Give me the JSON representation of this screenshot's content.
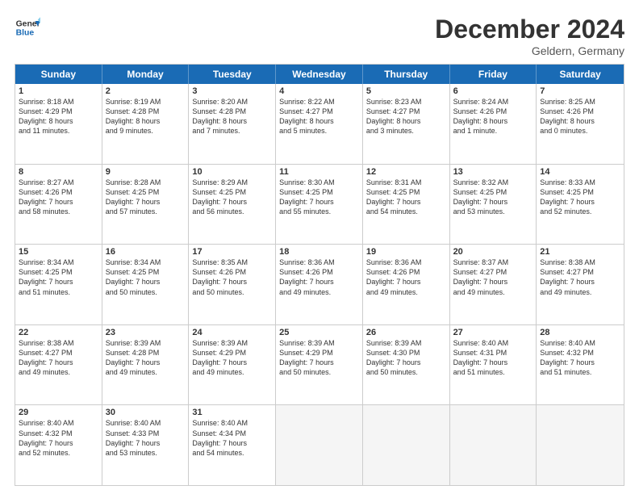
{
  "logo": {
    "line1": "General",
    "line2": "Blue"
  },
  "header": {
    "title": "December 2024",
    "subtitle": "Geldern, Germany"
  },
  "days": [
    "Sunday",
    "Monday",
    "Tuesday",
    "Wednesday",
    "Thursday",
    "Friday",
    "Saturday"
  ],
  "weeks": [
    [
      {
        "day": "1",
        "info": "Sunrise: 8:18 AM\nSunset: 4:29 PM\nDaylight: 8 hours\nand 11 minutes."
      },
      {
        "day": "2",
        "info": "Sunrise: 8:19 AM\nSunset: 4:28 PM\nDaylight: 8 hours\nand 9 minutes."
      },
      {
        "day": "3",
        "info": "Sunrise: 8:20 AM\nSunset: 4:28 PM\nDaylight: 8 hours\nand 7 minutes."
      },
      {
        "day": "4",
        "info": "Sunrise: 8:22 AM\nSunset: 4:27 PM\nDaylight: 8 hours\nand 5 minutes."
      },
      {
        "day": "5",
        "info": "Sunrise: 8:23 AM\nSunset: 4:27 PM\nDaylight: 8 hours\nand 3 minutes."
      },
      {
        "day": "6",
        "info": "Sunrise: 8:24 AM\nSunset: 4:26 PM\nDaylight: 8 hours\nand 1 minute."
      },
      {
        "day": "7",
        "info": "Sunrise: 8:25 AM\nSunset: 4:26 PM\nDaylight: 8 hours\nand 0 minutes."
      }
    ],
    [
      {
        "day": "8",
        "info": "Sunrise: 8:27 AM\nSunset: 4:26 PM\nDaylight: 7 hours\nand 58 minutes."
      },
      {
        "day": "9",
        "info": "Sunrise: 8:28 AM\nSunset: 4:25 PM\nDaylight: 7 hours\nand 57 minutes."
      },
      {
        "day": "10",
        "info": "Sunrise: 8:29 AM\nSunset: 4:25 PM\nDaylight: 7 hours\nand 56 minutes."
      },
      {
        "day": "11",
        "info": "Sunrise: 8:30 AM\nSunset: 4:25 PM\nDaylight: 7 hours\nand 55 minutes."
      },
      {
        "day": "12",
        "info": "Sunrise: 8:31 AM\nSunset: 4:25 PM\nDaylight: 7 hours\nand 54 minutes."
      },
      {
        "day": "13",
        "info": "Sunrise: 8:32 AM\nSunset: 4:25 PM\nDaylight: 7 hours\nand 53 minutes."
      },
      {
        "day": "14",
        "info": "Sunrise: 8:33 AM\nSunset: 4:25 PM\nDaylight: 7 hours\nand 52 minutes."
      }
    ],
    [
      {
        "day": "15",
        "info": "Sunrise: 8:34 AM\nSunset: 4:25 PM\nDaylight: 7 hours\nand 51 minutes."
      },
      {
        "day": "16",
        "info": "Sunrise: 8:34 AM\nSunset: 4:25 PM\nDaylight: 7 hours\nand 50 minutes."
      },
      {
        "day": "17",
        "info": "Sunrise: 8:35 AM\nSunset: 4:26 PM\nDaylight: 7 hours\nand 50 minutes."
      },
      {
        "day": "18",
        "info": "Sunrise: 8:36 AM\nSunset: 4:26 PM\nDaylight: 7 hours\nand 49 minutes."
      },
      {
        "day": "19",
        "info": "Sunrise: 8:36 AM\nSunset: 4:26 PM\nDaylight: 7 hours\nand 49 minutes."
      },
      {
        "day": "20",
        "info": "Sunrise: 8:37 AM\nSunset: 4:27 PM\nDaylight: 7 hours\nand 49 minutes."
      },
      {
        "day": "21",
        "info": "Sunrise: 8:38 AM\nSunset: 4:27 PM\nDaylight: 7 hours\nand 49 minutes."
      }
    ],
    [
      {
        "day": "22",
        "info": "Sunrise: 8:38 AM\nSunset: 4:27 PM\nDaylight: 7 hours\nand 49 minutes."
      },
      {
        "day": "23",
        "info": "Sunrise: 8:39 AM\nSunset: 4:28 PM\nDaylight: 7 hours\nand 49 minutes."
      },
      {
        "day": "24",
        "info": "Sunrise: 8:39 AM\nSunset: 4:29 PM\nDaylight: 7 hours\nand 49 minutes."
      },
      {
        "day": "25",
        "info": "Sunrise: 8:39 AM\nSunset: 4:29 PM\nDaylight: 7 hours\nand 50 minutes."
      },
      {
        "day": "26",
        "info": "Sunrise: 8:39 AM\nSunset: 4:30 PM\nDaylight: 7 hours\nand 50 minutes."
      },
      {
        "day": "27",
        "info": "Sunrise: 8:40 AM\nSunset: 4:31 PM\nDaylight: 7 hours\nand 51 minutes."
      },
      {
        "day": "28",
        "info": "Sunrise: 8:40 AM\nSunset: 4:32 PM\nDaylight: 7 hours\nand 51 minutes."
      }
    ],
    [
      {
        "day": "29",
        "info": "Sunrise: 8:40 AM\nSunset: 4:32 PM\nDaylight: 7 hours\nand 52 minutes."
      },
      {
        "day": "30",
        "info": "Sunrise: 8:40 AM\nSunset: 4:33 PM\nDaylight: 7 hours\nand 53 minutes."
      },
      {
        "day": "31",
        "info": "Sunrise: 8:40 AM\nSunset: 4:34 PM\nDaylight: 7 hours\nand 54 minutes."
      },
      {
        "day": "",
        "info": ""
      },
      {
        "day": "",
        "info": ""
      },
      {
        "day": "",
        "info": ""
      },
      {
        "day": "",
        "info": ""
      }
    ]
  ]
}
